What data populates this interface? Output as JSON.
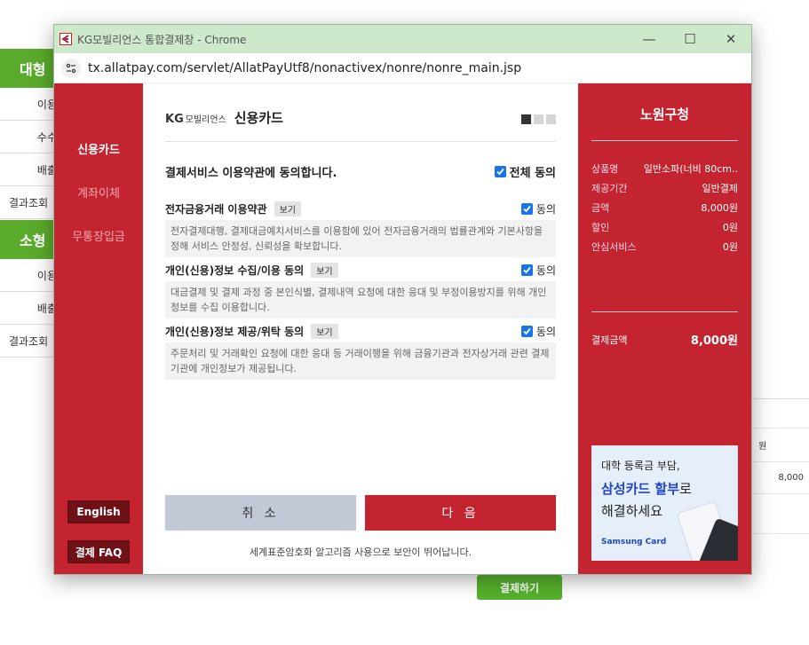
{
  "background_page": {
    "section1_title": "대형",
    "section1_rows": [
      "이용",
      "수수",
      "배출",
      "결과조회"
    ],
    "section2_title": "소형",
    "section2_rows": [
      "이용",
      "배출",
      "결과조회"
    ],
    "table_unit": "원",
    "table_amount": "8,000",
    "pay_button": "결제하기",
    "colors": {
      "green": "#5aab2c"
    }
  },
  "window": {
    "title": "KG모빌리언스 통합결제창 - Chrome",
    "url": "tx.allatpay.com/servlet/AllatPayUtf8/nonactivex/nonre/nonre_main.jsp",
    "controls": {
      "minimize": "—",
      "maximize": "☐",
      "close": "✕"
    }
  },
  "left_nav": {
    "items": [
      {
        "label": "신용카드",
        "active": true
      },
      {
        "label": "계좌이체",
        "active": false
      },
      {
        "label": "무통장입금",
        "active": false
      }
    ],
    "english_button": "English",
    "faq_button": "결제 FAQ"
  },
  "main": {
    "brand_logo": "KG",
    "brand_logo_sub": "모빌리언스",
    "title": "신용카드",
    "step_indicator": {
      "total": 3,
      "current": 1
    },
    "agree_heading": "결제서비스 이용약관에 동의합니다.",
    "agree_all_label": "전체 동의",
    "agree_all_checked": true,
    "terms": [
      {
        "title": "전자금융거래 이용약관",
        "view_label": "보기",
        "agree_label": "동의",
        "checked": true,
        "text": "전자결제대행, 결제대금예치서비스를 이용함에 있어 전자금융거래의 법률관계와 기본사항을 정해 서비스 안정성, 신뢰성을 확보합니다."
      },
      {
        "title": "개인(신용)정보 수집/이용 동의",
        "view_label": "보기",
        "agree_label": "동의",
        "checked": true,
        "text": "대금결제 및 결제 과정 중 본인식별, 결제내역 요청에 대한 응대 및 부정이용방지를 위해 개인정보를 수집 이용합니다."
      },
      {
        "title": "개인(신용)정보 제공/위탁 동의",
        "view_label": "보기",
        "agree_label": "동의",
        "checked": true,
        "text": "주문처리 및 거래확인 요청에 대한 응대 등 거래이행을 위해 금융기관과 전자상거래 관련 결제기관에 개인정보가 제공됩니다."
      }
    ],
    "cancel_button": "취 소",
    "next_button": "다 음",
    "secure_note": "세계표준암호화 알고리즘 사용으로 보안이 뛰어납니다."
  },
  "order_panel": {
    "shop_name": "노원구청",
    "rows": [
      {
        "key": "상품명",
        "value": "일반소파(너비 80cm.."
      },
      {
        "key": "제공기간",
        "value": "일반결제"
      },
      {
        "key": "금액",
        "value": "8,000원"
      },
      {
        "key": "할인",
        "value": "0원"
      },
      {
        "key": "안심서비스",
        "value": "0원"
      }
    ],
    "total_label": "결제금액",
    "total_value": "8,000원",
    "ad": {
      "line1": "대학 등록금 부담,",
      "line2_highlight": "삼성카드 할부",
      "line2_rest": "로",
      "line3": "해결하세요",
      "brand": "Samsung Card"
    },
    "colors": {
      "panel_red": "#c4242f",
      "ad_blue": "#1d46c8"
    }
  }
}
